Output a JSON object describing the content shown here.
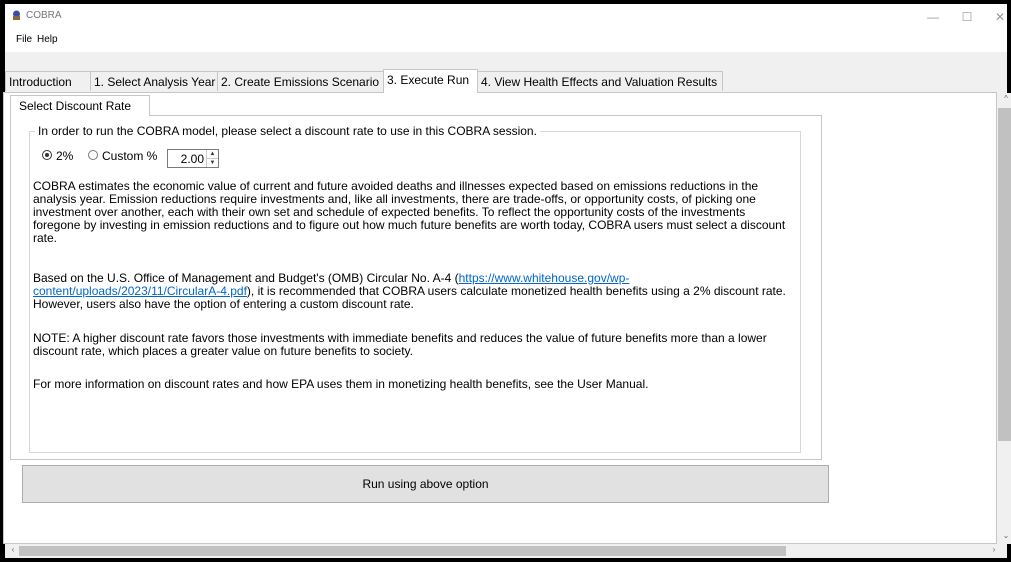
{
  "window": {
    "title": "COBRA"
  },
  "menu": {
    "file": "File",
    "help": "Help"
  },
  "tabs": [
    {
      "label": "Introduction"
    },
    {
      "label": "1. Select Analysis Year"
    },
    {
      "label": "2. Create Emissions Scenario"
    },
    {
      "label": "3. Execute Run"
    },
    {
      "label": "4. View Health Effects and Valuation Results"
    }
  ],
  "active_tab": 3,
  "subtab": {
    "label": "Select Discount Rate"
  },
  "group": {
    "legend": "In order to run the COBRA model, please select a discount rate to use in this COBRA session."
  },
  "options": {
    "rate_2_label": "2%",
    "custom_label": "Custom %",
    "custom_value": "2.00",
    "selected": "2%"
  },
  "paragraphs": {
    "p1": "COBRA estimates the economic value of current and future avoided deaths and illnesses expected based on emissions reductions in the analysis year. Emission reductions require investments and, like all investments, there are trade-offs, or opportunity costs, of picking one investment over another, each with their own set and schedule of expected benefits. To reflect the opportunity costs of the investments foregone by investing in emission reductions and to figure out how much future benefits are worth today, COBRA users must select a discount rate.",
    "p2_before": "Based on the U.S. Office of Management and Budget's (OMB) Circular No. A-4 (",
    "p2_link": "https://www.whitehouse.gov/wp-content/uploads/2023/11/CircularA-4.pdf",
    "p2_after": "), it is recommended that COBRA users calculate monetized health benefits using a 2% discount rate. However, users also have the option of entering a custom discount rate.",
    "p3": "NOTE: A higher discount rate favors those investments with immediate benefits and reduces the value of future benefits more than a lower discount rate, which places a greater value on future benefits to society.",
    "p4": "For more information on discount rates and how EPA uses them in monetizing health benefits, see the User Manual."
  },
  "run_button": {
    "label": "Run using above option"
  },
  "colors": {
    "link": "#0066cc",
    "button_bg": "#e1e1e1",
    "scroll_thumb": "#c1c1c1"
  }
}
